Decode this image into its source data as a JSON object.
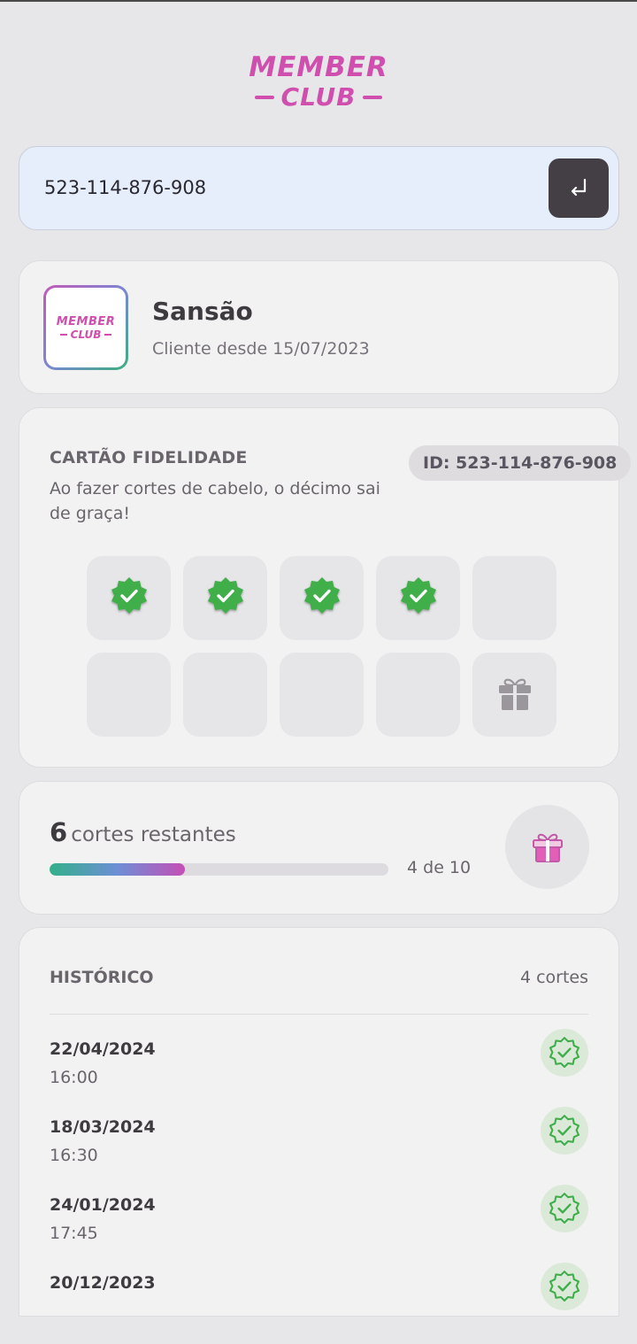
{
  "brand": {
    "line1": "MEMBER",
    "line2": "CLUB"
  },
  "search": {
    "value": "523-114-876-908",
    "submit_icon": "enter-return-icon"
  },
  "profile": {
    "name": "Sansão",
    "since": "Cliente desde 15/07/2023"
  },
  "loyalty": {
    "title": "CARTÃO FIDELIDADE",
    "description": "Ao fazer cortes de cabelo, o décimo sai de graça!",
    "id_badge": "ID: 523-114-876-908",
    "total_slots": 10,
    "completed_slots": 4,
    "final_slot_icon": "gift-icon"
  },
  "progress": {
    "remaining_number": "6",
    "remaining_label": "cortes restantes",
    "fraction": 0.4,
    "count_text": "4 de 10"
  },
  "history": {
    "title": "HISTÓRICO",
    "count": "4 cortes",
    "items": [
      {
        "date": "22/04/2024",
        "time": "16:00"
      },
      {
        "date": "18/03/2024",
        "time": "16:30"
      },
      {
        "date": "24/01/2024",
        "time": "17:45"
      },
      {
        "date": "20/12/2023",
        "time": ""
      }
    ]
  },
  "colors": {
    "accent": "#d04fae",
    "check_green": "#3fae4a",
    "background": "#e7e6e9",
    "card": "#f3f2f3"
  }
}
